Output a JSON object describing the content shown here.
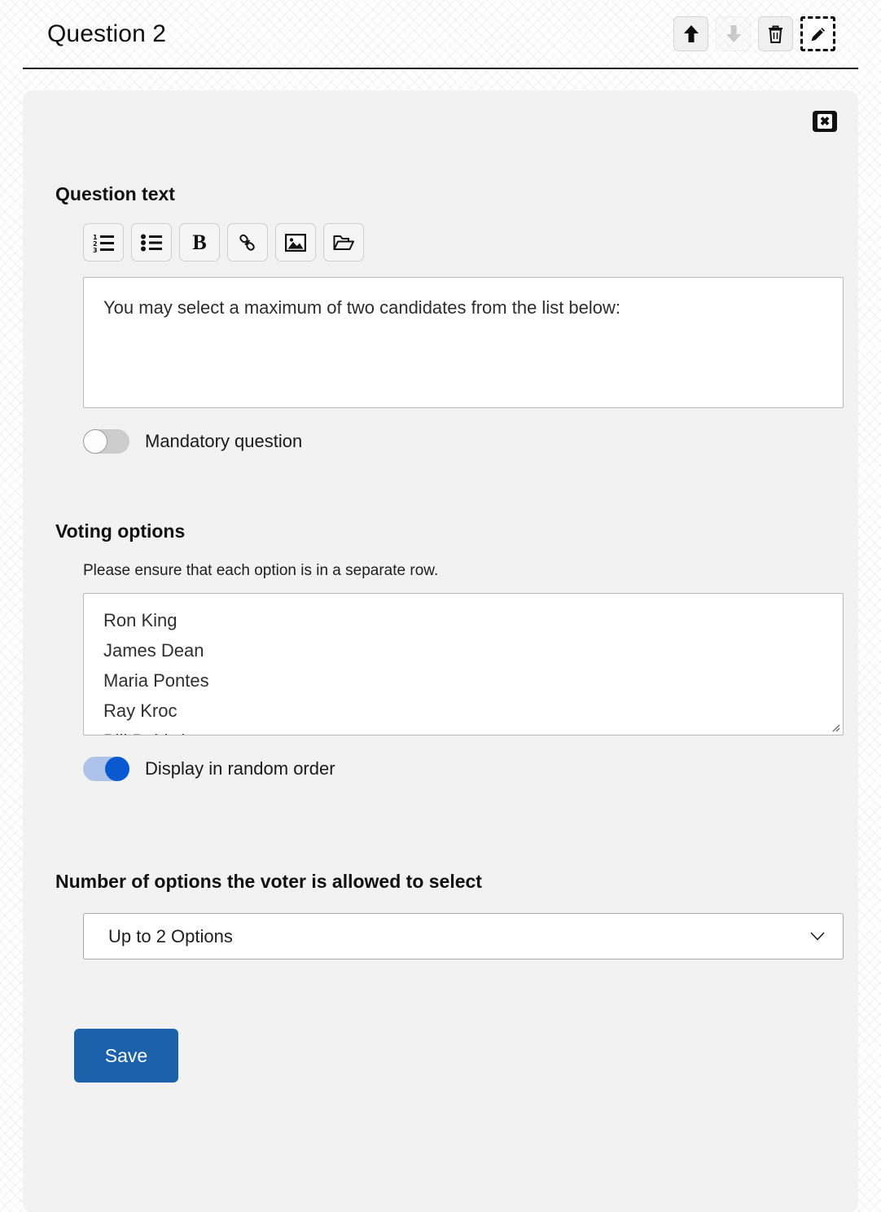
{
  "header": {
    "title": "Question 2",
    "actions": [
      {
        "name": "move-up-button",
        "icon": "arrow-up-icon",
        "state": "enabled"
      },
      {
        "name": "move-down-button",
        "icon": "arrow-down-icon",
        "state": "disabled"
      },
      {
        "name": "delete-button",
        "icon": "trash-icon",
        "state": "enabled"
      },
      {
        "name": "edit-button",
        "icon": "pencil-icon",
        "state": "focused"
      }
    ]
  },
  "panel": {
    "close_label": "✖",
    "question_text": {
      "heading": "Question text",
      "toolbar": [
        {
          "label": "numbered-list",
          "icon": "ordered-list-icon"
        },
        {
          "label": "bullet-list",
          "icon": "unordered-list-icon"
        },
        {
          "label": "bold",
          "icon": "bold-icon",
          "glyph": "B"
        },
        {
          "label": "link",
          "icon": "link-icon"
        },
        {
          "label": "image",
          "icon": "image-icon"
        },
        {
          "label": "file",
          "icon": "folder-open-icon"
        }
      ],
      "value": "You may select a maximum of two candidates from the list below:"
    },
    "mandatory_toggle": {
      "label": "Mandatory question",
      "state": "off"
    },
    "voting_options": {
      "heading": "Voting options",
      "helper": "Please ensure that each option is in a separate row.",
      "lines": [
        "Ron King",
        "James Dean",
        "Maria Pontes",
        "Ray Kroc",
        "Bill Baldwin"
      ],
      "random_toggle": {
        "label": "Display in random order",
        "state": "on"
      }
    },
    "max_select": {
      "heading": "Number of options the voter is allowed to select",
      "selected": "Up to 2 Options"
    },
    "save_label": "Save"
  },
  "colors": {
    "save_blue": "#1b62ab",
    "toggle_on_knob": "#0b59d0",
    "toggle_on_track": "#aec3ec",
    "toggle_off_track": "#cdcdcd",
    "panel_bg": "#f2f2f2"
  }
}
